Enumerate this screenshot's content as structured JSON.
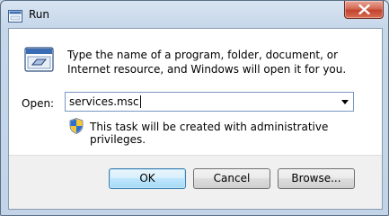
{
  "window": {
    "title": "Run",
    "icon": "run-dialog-icon",
    "close_icon": "close-icon"
  },
  "body": {
    "description": "Type the name of a program, folder, document, or Internet resource, and Windows will open it for you.",
    "open_label": "Open:",
    "open_value": "services.msc",
    "admin_notice": "This task will be created with administrative privileges."
  },
  "buttons": {
    "ok": "OK",
    "cancel": "Cancel",
    "browse": "Browse..."
  },
  "colors": {
    "close_button": "#c1432d",
    "default_button_border": "#3c7fb1",
    "frame": "#c3d4e8"
  }
}
